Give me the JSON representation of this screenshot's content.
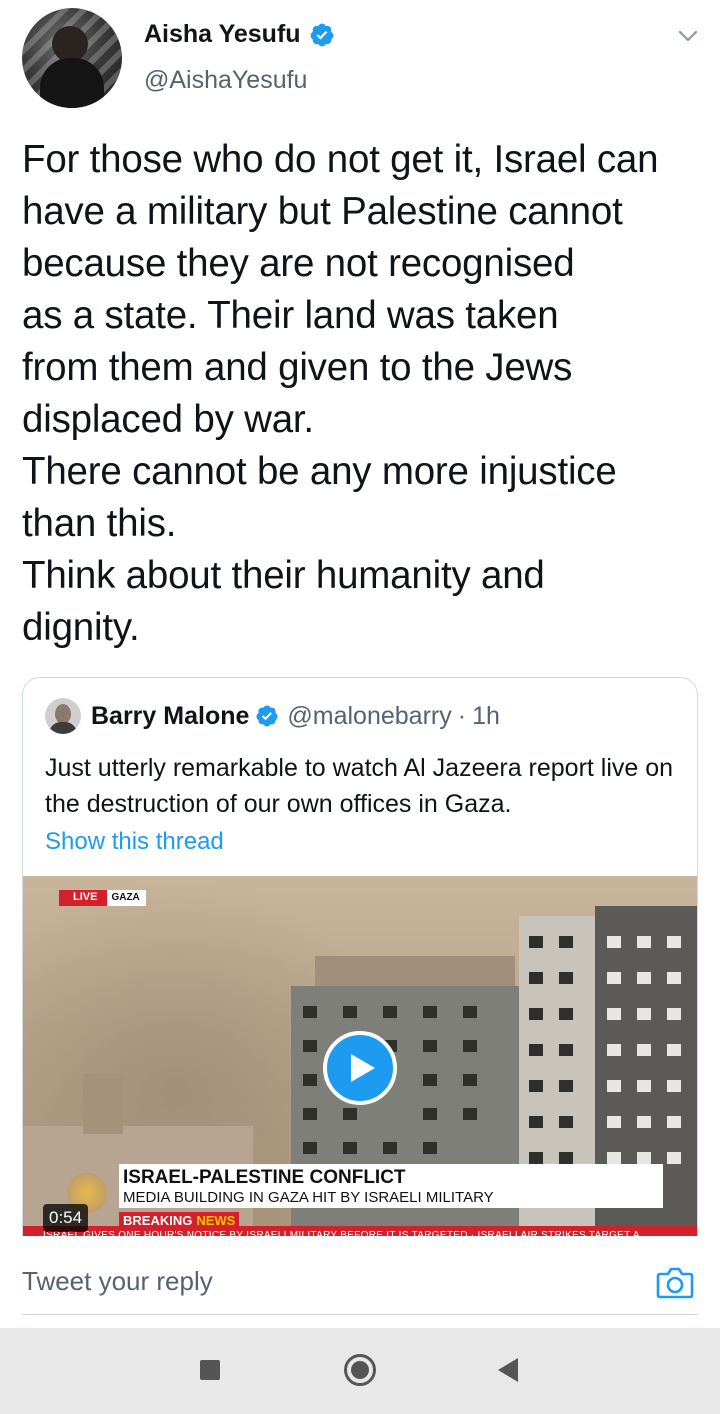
{
  "author": {
    "name": "Aisha Yesufu",
    "handle": "@AishaYesufu",
    "verified": true,
    "avatar_icon": "avatar-photo"
  },
  "tweet": {
    "lines": [
      "For those who do not get it, Israel can",
      "have a military but Palestine cannot",
      "because they are not recognised",
      "as a state. Their land was taken",
      "from them and given to the Jews",
      "displaced by war.",
      "There cannot be any more injustice",
      "than this.",
      "Think about their humanity and",
      "dignity."
    ]
  },
  "quoted": {
    "name": "Barry Malone",
    "handle": "@malonebarry",
    "separator": "·",
    "time": "1h",
    "text": "Just utterly remarkable to watch Al Jazeera report live on the destruction of our own offices in Gaza.",
    "show_thread": "Show this thread",
    "media": {
      "live_label": "LIVE",
      "location_label": "GAZA",
      "headline": "ISRAEL-PALESTINE CONFLICT",
      "subheadline": "MEDIA BUILDING IN GAZA HIT BY ISRAELI MILITARY",
      "breaking_a": "BREAKING",
      "breaking_b": "NEWS",
      "ticker": "ISRAEL GIVES ONE HOUR'S NOTICE BY ISRAELI MILITARY BEFORE IT IS TARGETED  ·  ISRAELI AIR STRIKES TARGET A",
      "duration": "0:54"
    }
  },
  "reply": {
    "placeholder": "Tweet your reply",
    "camera_icon": "camera-icon"
  },
  "colors": {
    "accent": "#1d9bf0",
    "text": "#0f1419",
    "secondary": "#536471",
    "border": "#cfd9de",
    "news_red": "#d4202a"
  }
}
